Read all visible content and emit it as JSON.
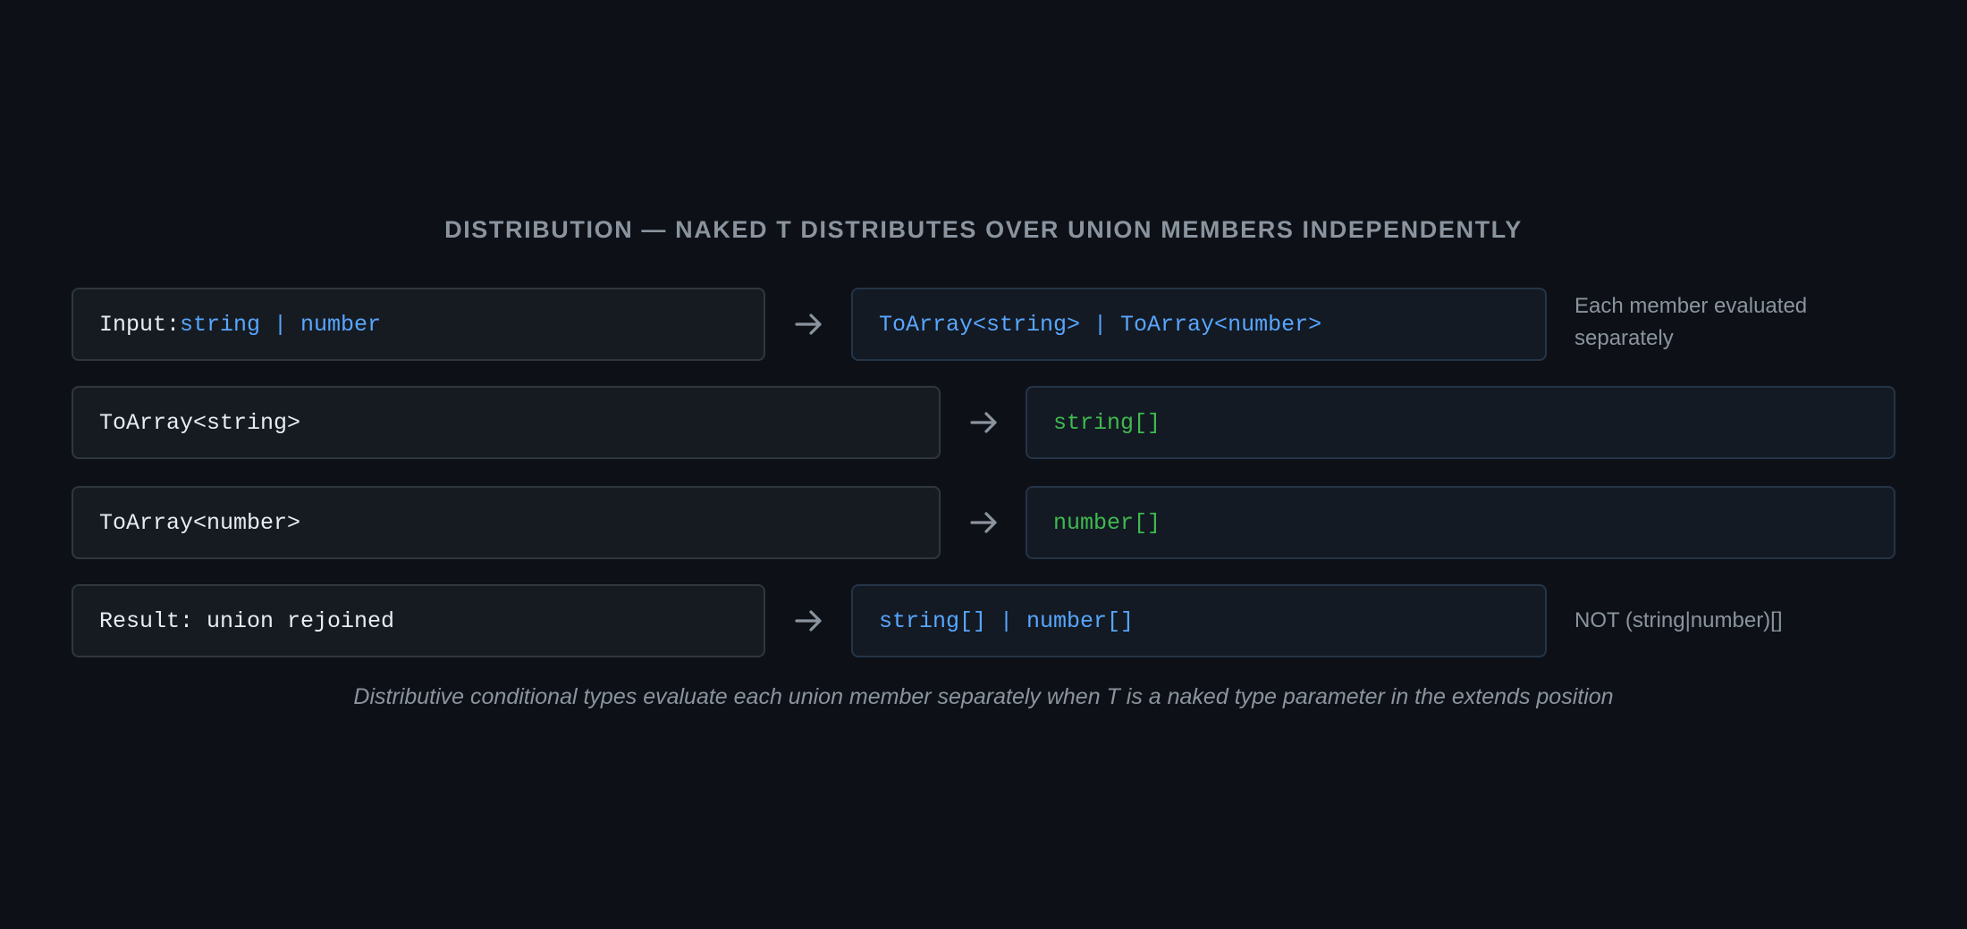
{
  "title": "DISTRIBUTION — NAKED T DISTRIBUTES OVER UNION MEMBERS INDEPENDENTLY",
  "rows": [
    {
      "left_prefix": "Input: ",
      "left_value": "string | number",
      "right_value": "ToArray<string> | ToArray<number>",
      "note": "Each member evaluated separately"
    },
    {
      "left_value": "ToArray<string>",
      "right_value": "string[]"
    },
    {
      "left_value": "ToArray<number>",
      "right_value": "number[]"
    },
    {
      "left_value": "Result: union rejoined",
      "right_value": "string[] | number[]",
      "note": "NOT (string|number)[]"
    }
  ],
  "caption": "Distributive conditional types evaluate each union member separately when T is a naked type parameter in the extends position",
  "colors": {
    "background": "#0d1117",
    "box": "#161b22",
    "border": "#30363d",
    "code_blue": "#58a6ff",
    "code_green": "#3fb950",
    "muted": "#8b949e",
    "arrow": "#8b949e"
  },
  "icons": {
    "arrow": "arrow-right-icon"
  }
}
